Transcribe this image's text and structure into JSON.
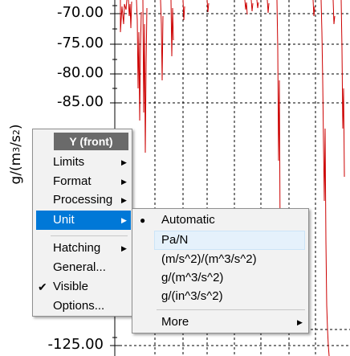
{
  "axis": {
    "unit_label_base": "g/(m",
    "unit_label_exp1": "3",
    "unit_label_mid": "/s",
    "unit_label_exp2": "2",
    "unit_label_end": ")",
    "ticks": [
      "-70.00",
      "-75.00",
      "-80.00",
      "-85.00",
      "-125.00"
    ]
  },
  "context_menu": {
    "title": "Y (front)",
    "items": [
      {
        "label": "Limits",
        "submenu": true
      },
      {
        "label": "Format",
        "submenu": true
      },
      {
        "label": "Processing",
        "submenu": true
      },
      {
        "label": "Unit",
        "submenu": true,
        "highlighted": true
      },
      {
        "label": "Hatching",
        "submenu": true
      },
      {
        "label": "General...",
        "submenu": false
      },
      {
        "label": "Visible",
        "submenu": false,
        "checked": true
      },
      {
        "label": "Options...",
        "submenu": false
      }
    ]
  },
  "unit_submenu": {
    "items": [
      {
        "label": "Automatic",
        "selected": true
      },
      {
        "label": "Pa/N",
        "hover": true
      },
      {
        "label": "(m/s^2)/(m^3/s^2)"
      },
      {
        "label": "g/(m^3/s^2)"
      },
      {
        "label": "g/(in^3/s^2)"
      }
    ],
    "more_label": "More"
  },
  "colors": {
    "signal": "#cc0000",
    "grid": "#000000",
    "menu_highlight": "#0078d7",
    "menu_title_bg": "#6a6a6a"
  }
}
